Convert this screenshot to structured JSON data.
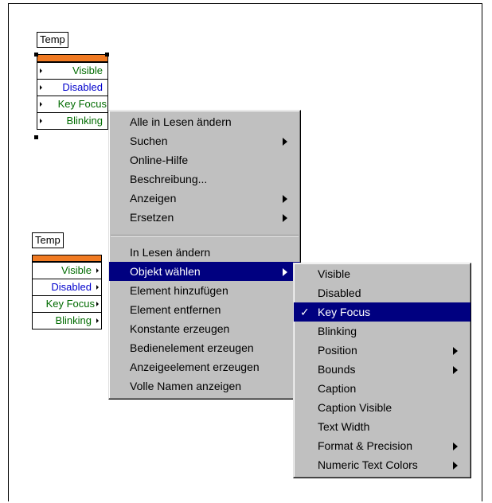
{
  "node1": {
    "label": "Temp",
    "rows": [
      {
        "text": "Visible",
        "color": "#006b00"
      },
      {
        "text": "Disabled",
        "color": "#0000cc"
      },
      {
        "text": "Key Focus",
        "color": "#006b00"
      },
      {
        "text": "Blinking",
        "color": "#006b00"
      }
    ]
  },
  "node2": {
    "label": "Temp",
    "rows": [
      {
        "text": "Visible",
        "color": "#006b00"
      },
      {
        "text": "Disabled",
        "color": "#0000cc"
      },
      {
        "text": "Key Focus",
        "color": "#006b00"
      },
      {
        "text": "Blinking",
        "color": "#006b00"
      }
    ]
  },
  "context_menu": {
    "group1": [
      {
        "label": "Alle in Lesen ändern",
        "submenu": false
      },
      {
        "label": "Suchen",
        "submenu": true
      },
      {
        "label": "Online-Hilfe",
        "submenu": false
      },
      {
        "label": "Beschreibung...",
        "submenu": false
      },
      {
        "label": "Anzeigen",
        "submenu": true
      },
      {
        "label": "Ersetzen",
        "submenu": true
      }
    ],
    "group2": [
      {
        "label": "In Lesen ändern",
        "submenu": false
      },
      {
        "label": "Objekt wählen",
        "submenu": true,
        "selected": true
      },
      {
        "label": "Element hinzufügen",
        "submenu": false
      },
      {
        "label": "Element entfernen",
        "submenu": false
      },
      {
        "label": "Konstante erzeugen",
        "submenu": false
      },
      {
        "label": "Bedienelement erzeugen",
        "submenu": false
      },
      {
        "label": "Anzeigeelement erzeugen",
        "submenu": false
      },
      {
        "label": "Volle Namen anzeigen",
        "submenu": false
      }
    ]
  },
  "submenu": {
    "checkmark": "✓",
    "items": [
      {
        "label": "Visible",
        "submenu": false
      },
      {
        "label": "Disabled",
        "submenu": false
      },
      {
        "label": "Key Focus",
        "submenu": false,
        "selected": true,
        "checked": true
      },
      {
        "label": "Blinking",
        "submenu": false
      },
      {
        "label": "Position",
        "submenu": true
      },
      {
        "label": "Bounds",
        "submenu": true
      },
      {
        "label": "Caption",
        "submenu": false
      },
      {
        "label": "Caption Visible",
        "submenu": false
      },
      {
        "label": "Text Width",
        "submenu": false
      },
      {
        "label": "Format & Precision",
        "submenu": true
      },
      {
        "label": "Numeric Text Colors",
        "submenu": true
      }
    ]
  },
  "colors": {
    "node_bar": "#f07a22",
    "selection": "#000080",
    "menu_bg": "#c0c0c0"
  }
}
